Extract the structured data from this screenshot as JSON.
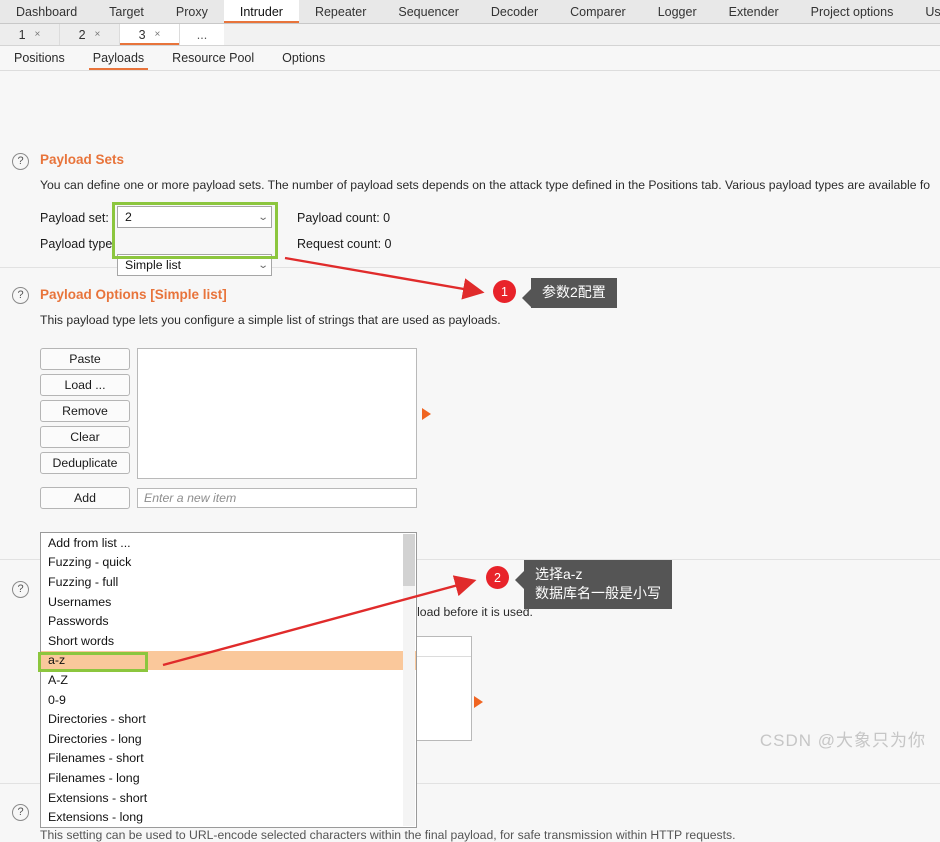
{
  "app": {
    "main_tabs": [
      {
        "label": "Dashboard",
        "active": false
      },
      {
        "label": "Target",
        "active": false
      },
      {
        "label": "Proxy",
        "active": false
      },
      {
        "label": "Intruder",
        "active": true
      },
      {
        "label": "Repeater",
        "active": false
      },
      {
        "label": "Sequencer",
        "active": false
      },
      {
        "label": "Decoder",
        "active": false
      },
      {
        "label": "Comparer",
        "active": false
      },
      {
        "label": "Logger",
        "active": false
      },
      {
        "label": "Extender",
        "active": false
      },
      {
        "label": "Project options",
        "active": false
      },
      {
        "label": "User options",
        "active": false
      }
    ],
    "attack_tabs": [
      {
        "label": "1",
        "close": "×",
        "active": false
      },
      {
        "label": "2",
        "close": "×",
        "active": false
      },
      {
        "label": "3",
        "close": "×",
        "active": true
      }
    ],
    "attack_tab_more": "...",
    "sub_tabs": [
      {
        "label": "Positions",
        "active": false
      },
      {
        "label": "Payloads",
        "active": true
      },
      {
        "label": "Resource Pool",
        "active": false
      },
      {
        "label": "Options",
        "active": false
      }
    ]
  },
  "payload_sets": {
    "help_icon": "help-question-icon",
    "title": "Payload Sets",
    "description": "You can define one or more payload sets. The number of payload sets depends on the attack type defined in the Positions tab. Various payload types are available fo",
    "payload_set_label": "Payload set:",
    "payload_set_value": "2",
    "payload_type_label": "Payload type",
    "payload_type_value": "Simple list",
    "payload_count": "Payload count: 0",
    "request_count": "Request count: 0",
    "chevron": "⌄"
  },
  "payload_options": {
    "help_icon": "help-question-icon",
    "title": "Payload Options [Simple list]",
    "description": "This payload type lets you configure a simple list of strings that are used as payloads.",
    "buttons": [
      {
        "label": "Paste"
      },
      {
        "label": "Load ..."
      },
      {
        "label": "Remove"
      },
      {
        "label": "Clear"
      },
      {
        "label": "Deduplicate"
      }
    ],
    "add_button": "Add",
    "add_input_placeholder": "Enter a new item",
    "add_from_list_label": "Add from list ...",
    "chevron": "⌄"
  },
  "dropdown": {
    "items": [
      {
        "label": "Add from list ...",
        "selected": false
      },
      {
        "label": "Fuzzing - quick",
        "selected": false
      },
      {
        "label": "Fuzzing - full",
        "selected": false
      },
      {
        "label": "Usernames",
        "selected": false
      },
      {
        "label": "Passwords",
        "selected": false
      },
      {
        "label": "Short words",
        "selected": false
      },
      {
        "label": "a-z",
        "selected": true
      },
      {
        "label": "A-Z",
        "selected": false
      },
      {
        "label": "0-9",
        "selected": false
      },
      {
        "label": "Directories - short",
        "selected": false
      },
      {
        "label": "Directories - long",
        "selected": false
      },
      {
        "label": "Filenames - short",
        "selected": false
      },
      {
        "label": "Filenames - long",
        "selected": false
      },
      {
        "label": "Extensions - short",
        "selected": false
      },
      {
        "label": "Extensions - long",
        "selected": false
      }
    ]
  },
  "payload_processing": {
    "help_icon": "help-question-icon",
    "description_tail": "yload before it is used."
  },
  "payload_encoding": {
    "help_icon": "help-question-icon",
    "description": "This setting can be used to URL-encode selected characters within the final payload, for safe transmission within HTTP requests."
  },
  "annotations": {
    "callout_1": {
      "badge": "1",
      "text": "参数2配置"
    },
    "callout_2": {
      "badge": "2",
      "line1": "选择a-z",
      "line2": "数据库名一般是小写"
    },
    "highlight_color": "#8cc63e",
    "arrow_color": "#e02b2b",
    "badge_color": "#e8232a"
  },
  "watermark": "CSDN @大象只为你"
}
